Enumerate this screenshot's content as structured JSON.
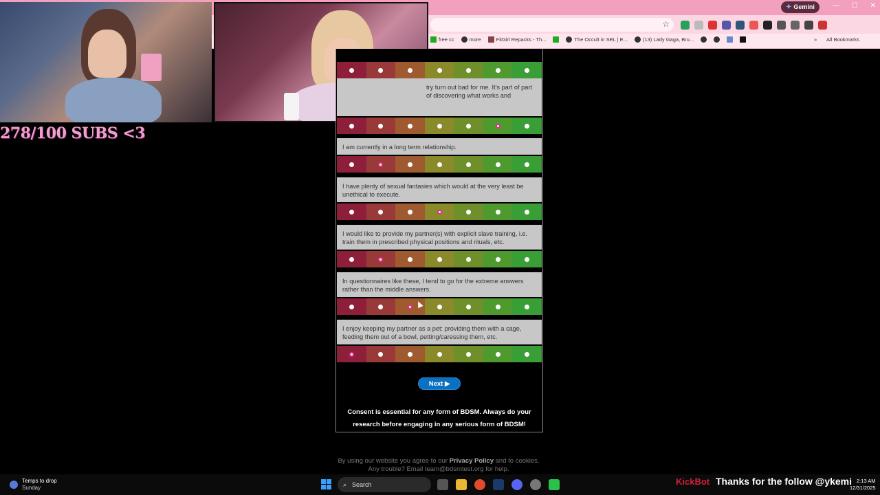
{
  "browser": {
    "gemini_label": "Gemini",
    "bookmarks": [
      "free cc",
      "more",
      "FitGirl Repacks - Th...",
      "The Occult in SEL | E...",
      "(13) Lady Gaga, Bru..."
    ],
    "all_bookmarks_label": "All Bookmarks"
  },
  "overlay": {
    "subs_text": "278/100 SUBS <3"
  },
  "survey": {
    "partial_question_1": "try turn out bad for me. It's part of part of discovering what works and",
    "questions": [
      {
        "text": "I am currently in a long term relationship.",
        "selected": 1
      },
      {
        "text": "I have plenty of sexual fantasies which would at the very least be unethical to execute.",
        "selected": 3
      },
      {
        "text": "I would like to provide my partner(s) with explicit slave training, i.e. train them in prescribed physical positions and rituals, etc.",
        "selected": 1
      },
      {
        "text": "In questionnaires like these, I tend to go for the extreme answers rather than the middle answers.",
        "selected": 2
      },
      {
        "text": "I enjoy keeping my partner as a pet: providing them with a cage, feeding them out of a bowl, petting/caressing them, etc.",
        "selected": 0
      }
    ],
    "partial_selected": 5,
    "next_label": "Next ▶",
    "consent_text": "Consent is essential for any form of BDSM. Always do your research before engaging in any serious form of BDSM!",
    "footer_text_1": "By using our website you agree to our",
    "footer_link": "Privacy Policy",
    "footer_text_2": "and to cookies. Any trouble? Email team@bdsmtest.org for help."
  },
  "taskbar": {
    "weather_title": "Temps to drop",
    "weather_sub": "Sunday",
    "search_label": "Search",
    "kickbot_label": "KickBot",
    "follow_text": "Thanks for the follow @ykemi",
    "time": "2:13 AM",
    "date": "12/31/2025"
  },
  "colors": {
    "scale": [
      "#8e1f3a",
      "#9a3a38",
      "#a05a30",
      "#8a8a2a",
      "#6f8f2a",
      "#4f9a2e",
      "#3a9e36"
    ],
    "accent_pink": "#f3a0be",
    "next_button": "#0a70c0"
  }
}
